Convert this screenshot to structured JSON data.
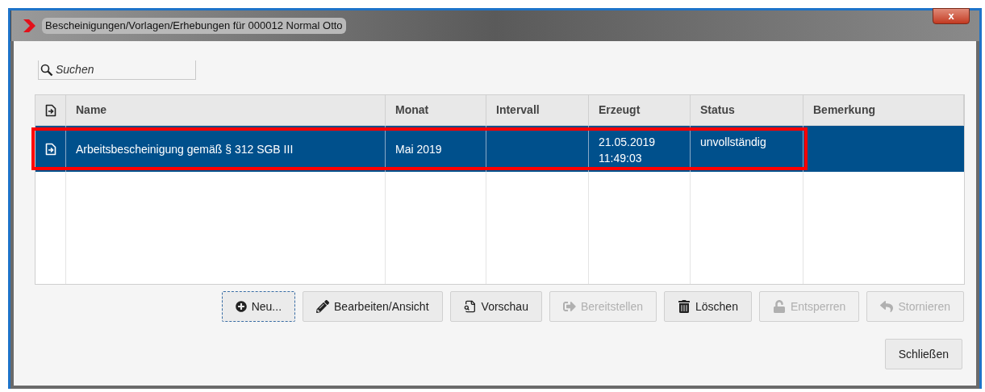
{
  "window": {
    "title": "Bescheinigungen/Vorlagen/Erhebungen für 000012 Normal Otto",
    "close": "x"
  },
  "search": {
    "placeholder": "Suchen"
  },
  "table": {
    "columns": [
      "Name",
      "Monat",
      "Intervall",
      "Erzeugt",
      "Status",
      "Bemerkung"
    ],
    "rows": [
      {
        "selected": true,
        "highlighted": true,
        "cells": [
          "Arbeitsbescheinigung gemäß § 312 SGB III",
          "Mai 2019",
          "",
          "21.05.2019\n11:49:03",
          "unvollständig",
          ""
        ]
      }
    ]
  },
  "buttons": [
    {
      "label": "Neu...",
      "kind": "plus",
      "disabled": false,
      "focused": true
    },
    {
      "label": "Bearbeiten/Ansicht",
      "kind": "pencil",
      "disabled": false,
      "focused": false
    },
    {
      "label": "Vorschau",
      "kind": "preview",
      "disabled": false,
      "focused": false
    },
    {
      "label": "Bereitstellen",
      "kind": "export",
      "disabled": true,
      "focused": false
    },
    {
      "label": "Löschen",
      "kind": "trash",
      "disabled": false,
      "focused": false
    },
    {
      "label": "Entsperren",
      "kind": "unlock",
      "disabled": true,
      "focused": false
    },
    {
      "label": "Stornieren",
      "kind": "undo",
      "disabled": true,
      "focused": false
    }
  ],
  "close_button": {
    "label": "Schließen"
  }
}
